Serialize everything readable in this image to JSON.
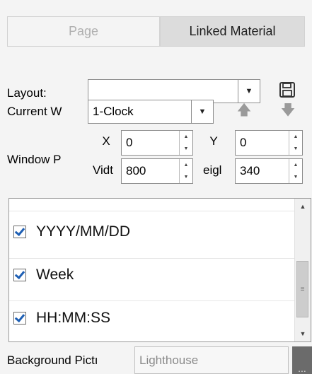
{
  "tabs": [
    {
      "label": "Page",
      "active": false
    },
    {
      "label": "Linked Material",
      "active": true
    }
  ],
  "layout": {
    "label": "Layout:",
    "value": ""
  },
  "current_window": {
    "label": "Current W",
    "value": "1-Clock"
  },
  "window_position": {
    "label": "Window P",
    "x_label": "X",
    "x_value": "0",
    "y_label": "Y",
    "y_value": "0",
    "width_label": "Vidt",
    "width_value": "800",
    "height_label": "eigl",
    "height_value": "340"
  },
  "list": {
    "items": [
      {
        "label": "YYYY/MM/DD",
        "checked": true
      },
      {
        "label": "Week",
        "checked": true
      },
      {
        "label": "HH:MM:SS",
        "checked": true
      }
    ]
  },
  "background_picture": {
    "label": "Background Pictı",
    "value": "Lighthouse",
    "browse_label": "..."
  },
  "icons": {
    "save": "save-icon",
    "move_up": "arrow-up-icon",
    "move_down": "arrow-down-icon",
    "dropdown": "chevron-down-icon",
    "spin_up": "spin-up-icon",
    "spin_down": "spin-down-icon",
    "check": "checkbox-checked-icon"
  },
  "colors": {
    "accent": "#1e5fb4",
    "active_tab": "#dcdcdc",
    "panel_bg": "#f4f4f4"
  }
}
